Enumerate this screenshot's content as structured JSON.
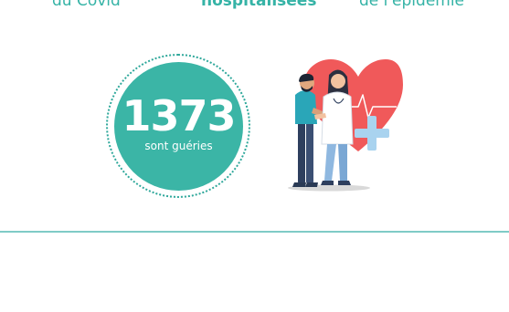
{
  "header": {
    "left_caption": "du Covid",
    "middle_caption": "hospitalisées",
    "right_caption": "de l'épidémie"
  },
  "stat": {
    "value": "1373",
    "label": "sont guéries"
  },
  "colors": {
    "accent": "#3bb5a6",
    "divider": "#7fcbc6",
    "heart": "#f0595a",
    "cross": "#a9d3ef"
  },
  "illustration": {
    "icon": "doctor-patient-heart-icon"
  }
}
